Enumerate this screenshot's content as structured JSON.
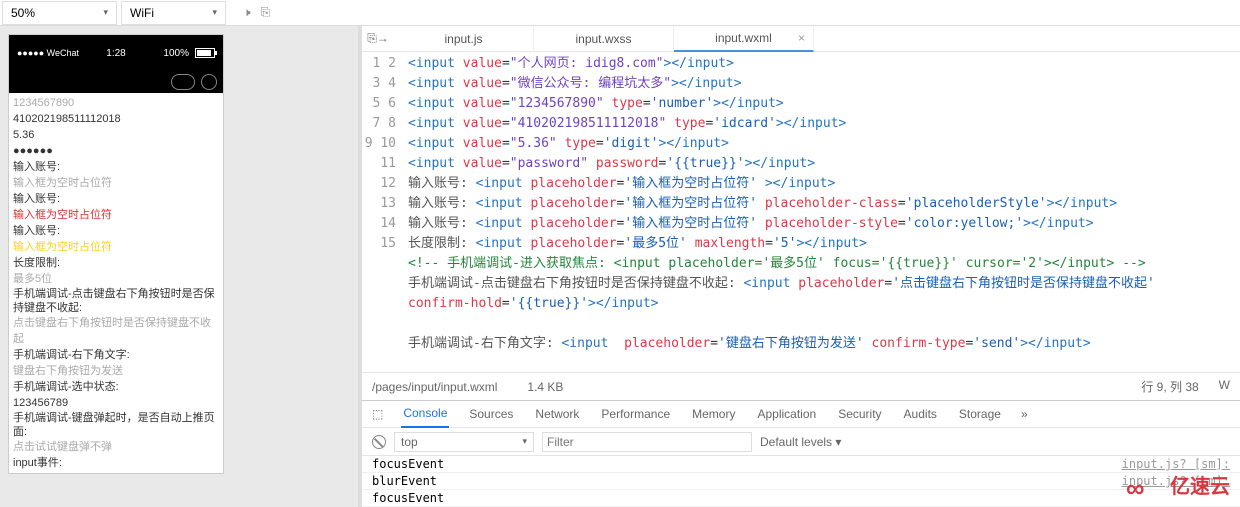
{
  "topbar": {
    "zoom": "50%",
    "network": "WiFi"
  },
  "tabs": [
    {
      "label": "input.js",
      "active": false
    },
    {
      "label": "input.wxss",
      "active": false
    },
    {
      "label": "input.wxml",
      "active": true
    }
  ],
  "phone": {
    "status_left": "●●●●● WeChat",
    "status_time": "1:28",
    "status_batt": "100%",
    "lines": [
      {
        "text": "1234567890",
        "cls": "gray"
      },
      {
        "text": "410202198511112018",
        "cls": ""
      },
      {
        "text": "5.36",
        "cls": ""
      },
      {
        "text": "●●●●●●",
        "cls": ""
      },
      {
        "text": "输入账号:",
        "cls": ""
      },
      {
        "text": "输入框为空时占位符",
        "cls": "gray"
      },
      {
        "text": "输入账号:",
        "cls": ""
      },
      {
        "text": "输入框为空时占位符",
        "cls": "red"
      },
      {
        "text": "输入账号:",
        "cls": ""
      },
      {
        "text": "输入框为空时占位符",
        "cls": "yellow"
      },
      {
        "text": "长度限制:",
        "cls": ""
      },
      {
        "text": "最多5位",
        "cls": "gray"
      },
      {
        "text": "手机端调试-点击键盘右下角按钮时是否保持键盘不收起:",
        "cls": ""
      },
      {
        "text": "点击键盘右下角按钮时是否保持键盘不收起",
        "cls": "gray"
      },
      {
        "text": "手机端调试-右下角文字:",
        "cls": ""
      },
      {
        "text": "键盘右下角按钮为发送",
        "cls": "gray"
      },
      {
        "text": "手机端调试-选中状态:",
        "cls": ""
      },
      {
        "text": "123456789",
        "cls": ""
      },
      {
        "text": "手机端调试-键盘弹起时，是否自动上推页面:",
        "cls": ""
      },
      {
        "text": "点击试试键盘弹不弹",
        "cls": "gray"
      },
      {
        "text": "input事件:",
        "cls": ""
      }
    ]
  },
  "code": {
    "lines": [
      1,
      2,
      3,
      4,
      5,
      6,
      7,
      8,
      9,
      10,
      11,
      12,
      "",
      13,
      14,
      15
    ],
    "l1a": "<",
    "l1b": "input",
    "l1c": "value",
    "l1d": "\"个人网页: idig8.com\"",
    "l1e": "></",
    "l1f": ">",
    "l2d": "\"微信公众号: 编程坑太多\"",
    "l3d": "\"1234567890\"",
    "l3t": "type",
    "l3tv": "'number'",
    "l4d": "\"410202198511112018\"",
    "l4tv": "'idcard'",
    "l5d": "\"5.36\"",
    "l5tv": "'digit'",
    "l6d": "\"password\"",
    "l6p": "password",
    "l6pv": "'{{true}}'",
    "l7a": "输入账号: ",
    "l7p": "placeholder",
    "l7pv": "'输入框为空时占位符'",
    "l7end": " ></",
    "l8pc": "placeholder-class",
    "l8pcv": "'placeholderStyle'",
    "l9ps": "placeholder-style",
    "l9psv": "'color:yellow;'",
    "l10a": "长度限制: ",
    "l10pv": "'最多5位'",
    "l10m": "maxlength",
    "l10mv": "'5'",
    "l11": "<!-- 手机端调试-进入获取焦点: <input placeholder='最多5位' focus='{{true}}' cursor='2'></input> -->",
    "l12a": "手机端调试-点击键盘右下角按钮时是否保持键盘不收起: ",
    "l12pv": "'点击键盘右下角按钮时是否保持键盘不收起'",
    "l12b": "confirm-hold",
    "l12bv": "'{{true}}'",
    "l14a": "手机端调试-右下角文字: ",
    "l14pv": "'键盘右下角按钮为发送'",
    "l14c": "confirm-type",
    "l14cv": "'send'"
  },
  "statusbar": {
    "path": "/pages/input/input.wxml",
    "size": "1.4 KB",
    "pos": "行 9, 列 38",
    "lang": "W"
  },
  "devtools": {
    "tabs": [
      "Console",
      "Sources",
      "Network",
      "Performance",
      "Memory",
      "Application",
      "Security",
      "Audits",
      "Storage"
    ],
    "top": "top",
    "filter_ph": "Filter",
    "levels": "Default levels ▾",
    "logs": [
      {
        "msg": "focusEvent",
        "src": "input.js? [sm]:"
      },
      {
        "msg": "blurEvent",
        "src": "input.js? [sm]:"
      },
      {
        "msg": "focusEvent",
        "src": ""
      }
    ]
  },
  "watermark": "亿速云"
}
